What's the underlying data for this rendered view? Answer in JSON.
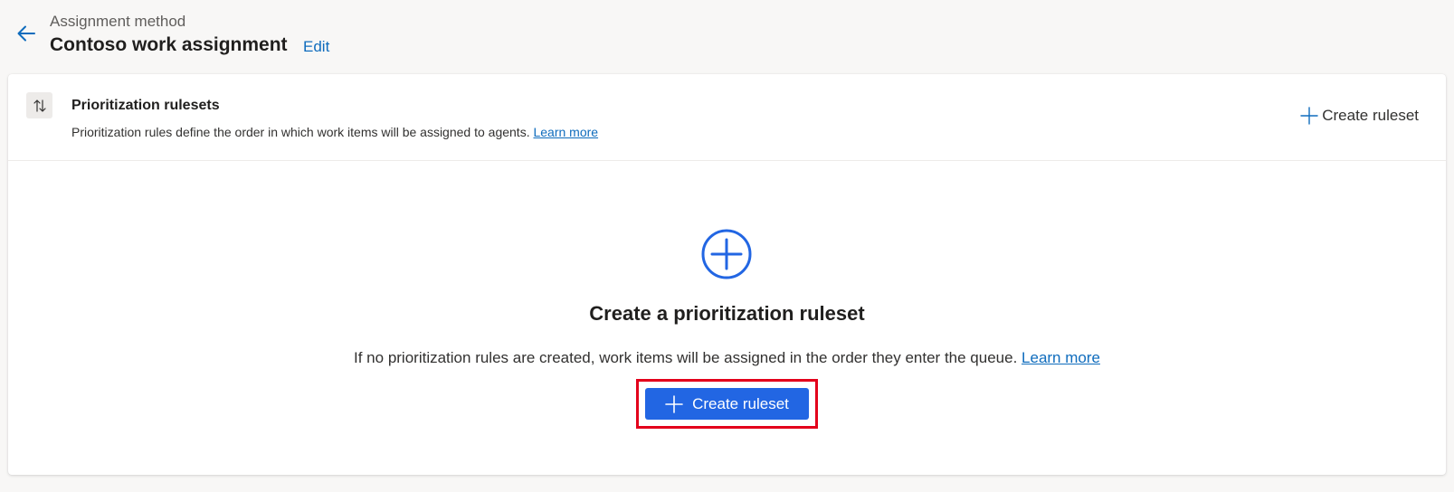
{
  "header": {
    "back_icon": "arrow-left-icon",
    "subtitle": "Assignment method",
    "title": "Contoso work assignment",
    "edit_label": "Edit"
  },
  "section": {
    "icon": "sort-arrows-icon",
    "title": "Prioritization rulesets",
    "description": "Prioritization rules define the order in which work items will be assigned to agents.",
    "learn_more": "Learn more",
    "create_label": "Create ruleset"
  },
  "empty_state": {
    "icon": "add-circle-icon",
    "title": "Create a prioritization ruleset",
    "description": "If no prioritization rules are created, work items will be assigned in the order they enter the queue.",
    "learn_more": "Learn more",
    "button_label": "Create ruleset"
  },
  "colors": {
    "accent": "#2266e3",
    "link": "#0f6cbd",
    "highlight": "#e3001b",
    "background": "#f8f7f6"
  }
}
